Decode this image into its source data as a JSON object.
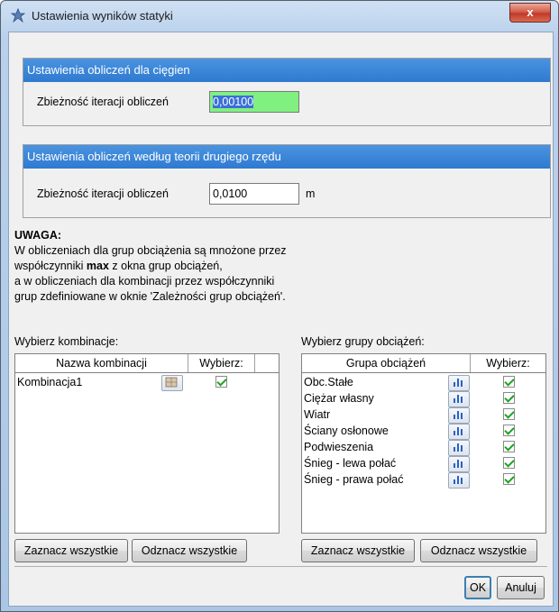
{
  "window": {
    "title": "Ustawienia wyników statyki",
    "close_label": "x"
  },
  "cable_group": {
    "header": "Ustawienia obliczeń dla cięgien",
    "label": "Zbieżność iteracji obliczeń",
    "value": "0,00100"
  },
  "second_order_group": {
    "header": "Ustawienia obliczeń według teorii drugiego rzędu",
    "label": "Zbieżność iteracji obliczeń",
    "value": "0,0100",
    "unit": "m"
  },
  "note": {
    "title": "UWAGA",
    "line1": "W obliczeniach dla grup obciążenia są mnożone przez",
    "line2_pre": "współczynniki ",
    "line2_bold": "max",
    "line2_post": " z okna grup obciążeń,",
    "line3": "a w obliczeniach dla kombinacji przez współczynniki",
    "line4": "grup zdefiniowane w oknie 'Zależności grup obciążeń'."
  },
  "combinations": {
    "label": "Wybierz kombinacje:",
    "col_name": "Nazwa kombinacji",
    "col_select": "Wybierz:",
    "rows": [
      {
        "name": "Kombinacja1",
        "checked": true
      }
    ],
    "select_all": "Zaznacz wszystkie",
    "deselect_all": "Odznacz wszystkie"
  },
  "load_groups": {
    "label": "Wybierz grupy obciążeń:",
    "col_name": "Grupa obciążeń",
    "col_select": "Wybierz:",
    "rows": [
      {
        "name": "Obc.Stałe",
        "checked": true
      },
      {
        "name": "Ciężar własny",
        "checked": true
      },
      {
        "name": "Wiatr",
        "checked": true
      },
      {
        "name": "Ściany osłonowe",
        "checked": true
      },
      {
        "name": "Podwieszenia",
        "checked": true
      },
      {
        "name": "Śnieg - lewa połać",
        "checked": true
      },
      {
        "name": "Śnieg - prawa połać",
        "checked": true
      }
    ],
    "select_all": "Zaznacz wszystkie",
    "deselect_all": "Odznacz wszystkie"
  },
  "footer": {
    "ok": "OK",
    "cancel": "Anuluj"
  },
  "colors": {
    "header_blue": "#2f7ad1",
    "field_green": "#80f080",
    "check_green": "#21a121"
  }
}
